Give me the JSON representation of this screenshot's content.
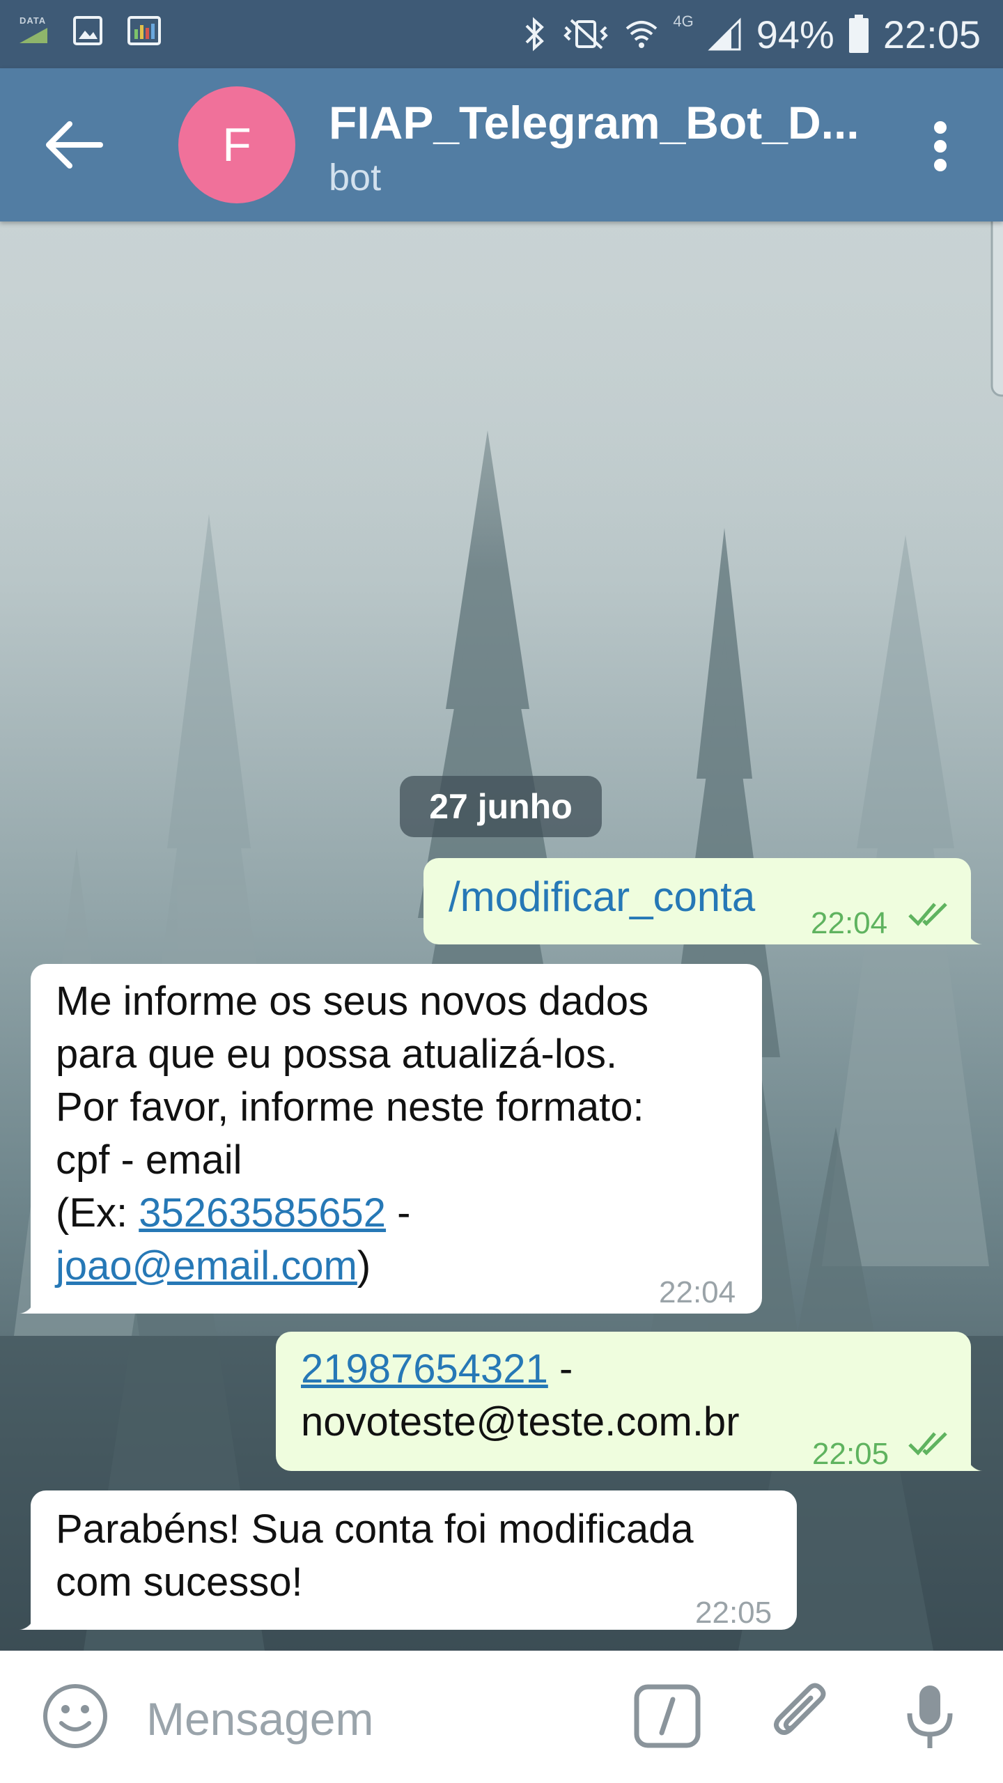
{
  "status_bar": {
    "data_label": "DATA",
    "network": "4G",
    "battery": "94%",
    "time": "22:05"
  },
  "header": {
    "avatar_letter": "F",
    "title": "FIAP_Telegram_Bot_D...",
    "subtitle": "bot"
  },
  "chat": {
    "date": "27 junho",
    "messages": [
      {
        "dir": "out",
        "text": "/modificar_conta",
        "time": "22:04"
      },
      {
        "dir": "in",
        "line1": "Me informe os seus novos dados",
        "line2": "para que eu possa atualizá-los.",
        "line3": "Por favor, informe neste formato:",
        "line4": "cpf - email",
        "ex_prefix": "(Ex: ",
        "ex_cpf": "35263585652",
        "ex_sep": " -",
        "ex_email": "joao@email.com",
        "ex_suffix": ")",
        "time": "22:04"
      },
      {
        "dir": "out",
        "cpf": "21987654321",
        "sep": " -",
        "email": "novoteste@teste.com.br",
        "time": "22:05"
      },
      {
        "dir": "in",
        "line1": "Parabéns! Sua conta foi modificada",
        "line2": "com sucesso!",
        "time": "22:05"
      }
    ]
  },
  "input": {
    "placeholder": "Mensagem"
  }
}
